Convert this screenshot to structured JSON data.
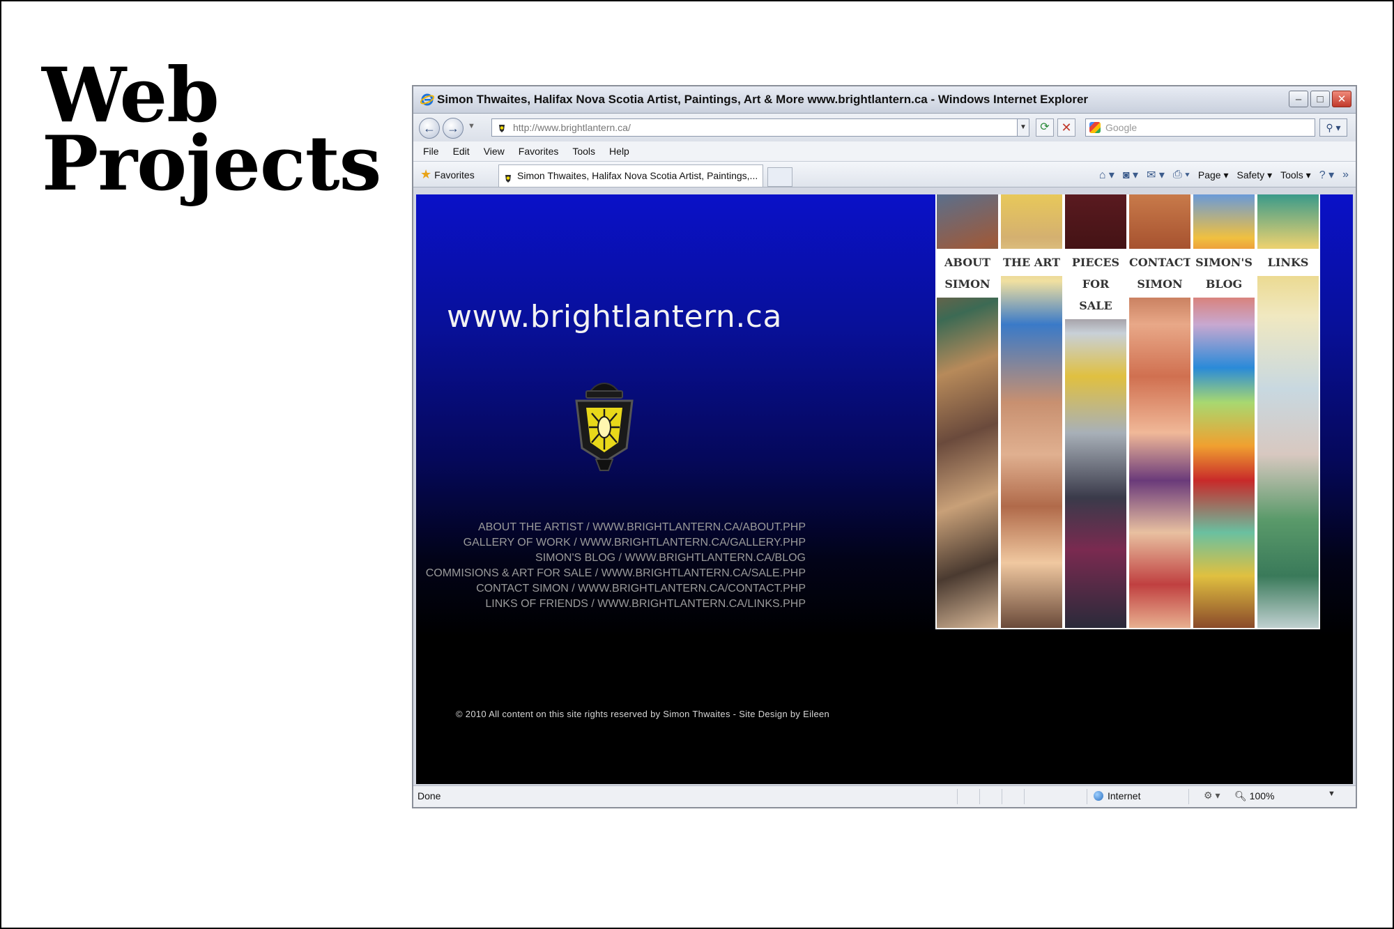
{
  "slide": {
    "heading_line1": "Web",
    "heading_line2": "Projects"
  },
  "browser": {
    "window_title": "Simon Thwaites, Halifax Nova Scotia Artist, Paintings, Art & More www.brightlantern.ca - Windows Internet Explorer",
    "address": "http://www.brightlantern.ca/",
    "search_placeholder": "Google",
    "menu": [
      "File",
      "Edit",
      "View",
      "Favorites",
      "Tools",
      "Help"
    ],
    "favorites_label": "Favorites",
    "tab_title": "Simon Thwaites, Halifax Nova Scotia Artist, Paintings,...",
    "command_bar": {
      "page": "Page",
      "safety": "Safety",
      "tools": "Tools"
    },
    "status": {
      "text": "Done",
      "zone": "Internet",
      "zoom": "100%"
    }
  },
  "website": {
    "site_title": "www.brightlantern.ca",
    "nav": [
      {
        "label_lines": [
          "ABOUT",
          "SIMON"
        ]
      },
      {
        "label_lines": [
          "THE ART"
        ]
      },
      {
        "label_lines": [
          "PIECES",
          "FOR",
          "SALE"
        ]
      },
      {
        "label_lines": [
          "CONTACT",
          "SIMON"
        ]
      },
      {
        "label_lines": [
          "SIMON'S",
          "BLOG"
        ]
      },
      {
        "label_lines": [
          "LINKS"
        ]
      }
    ],
    "text_links": [
      "ABOUT THE ARTIST / WWW.BRIGHTLANTERN.CA/ABOUT.PHP",
      "GALLERY OF WORK / WWW.BRIGHTLANTERN.CA/GALLERY.PHP",
      "SIMON'S BLOG / WWW.BRIGHTLANTERN.CA/BLOG",
      "COMMISIONS & ART FOR SALE / WWW.BRIGHTLANTERN.CA/SALE.PHP",
      "CONTACT SIMON / WWW.BRIGHTLANTERN.CA/CONTACT.PHP",
      "LINKS OF FRIENDS / WWW.BRIGHTLANTERN.CA/LINKS.PHP"
    ],
    "copyright": "© 2010 All content on this site rights reserved by Simon Thwaites - Site Design by Eileen"
  },
  "icons": {
    "browser": "ie-icon",
    "favicon": "lantern-favicon",
    "logo": "lantern-logo"
  }
}
